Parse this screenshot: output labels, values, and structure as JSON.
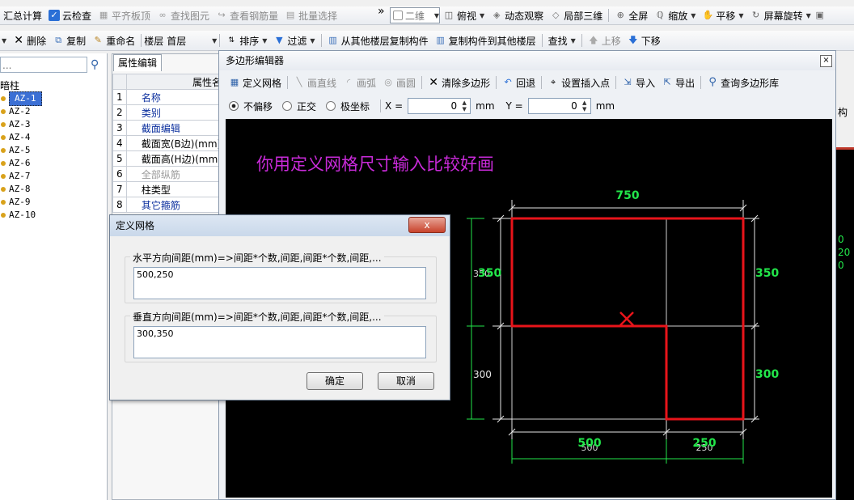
{
  "toolbar1": {
    "items": [
      {
        "label": "汇总计算",
        "icon": "sum-icon",
        "disabled": false
      },
      {
        "label": "云检查",
        "icon": "cloud-check-icon",
        "disabled": false
      },
      {
        "label": "平齐板顶",
        "icon": "align-icon",
        "disabled": true
      },
      {
        "label": "查找图元",
        "icon": "binoculars-icon",
        "disabled": true
      },
      {
        "label": "查看钢筋量",
        "icon": "rebar-icon",
        "disabled": true
      },
      {
        "label": "批量选择",
        "icon": "batch-select-icon",
        "disabled": true
      }
    ],
    "overflow": "»",
    "view_mode": "二维",
    "view_items": [
      {
        "label": "俯视",
        "has_dropdown": true
      },
      {
        "label": "动态观察",
        "has_dropdown": false
      },
      {
        "label": "局部三维",
        "has_dropdown": false
      },
      {
        "label": "全屏",
        "has_dropdown": false
      },
      {
        "label": "缩放",
        "has_dropdown": true
      },
      {
        "label": "平移",
        "has_dropdown": true
      },
      {
        "label": "屏幕旋转",
        "has_dropdown": true
      }
    ]
  },
  "toolbar2": {
    "delete": "删除",
    "copy": "复制",
    "rename": "重命名",
    "floor_label": "楼层",
    "floor_value": "首层",
    "sort": "排序",
    "filter": "过滤",
    "copy_from": "从其他楼层复制构件",
    "copy_to": "复制构件到其他楼层",
    "find": "查找",
    "up": "上移",
    "down": "下移"
  },
  "tree": {
    "search_placeholder": "...",
    "root": "暗柱",
    "items": [
      "AZ-1",
      "AZ-2",
      "AZ-3",
      "AZ-4",
      "AZ-5",
      "AZ-6",
      "AZ-7",
      "AZ-8",
      "AZ-9",
      "AZ-10"
    ],
    "selected": 0
  },
  "props": {
    "tab": "属性编辑",
    "header": "属性名",
    "rows": [
      {
        "no": "1",
        "name": "名称",
        "style": "blue"
      },
      {
        "no": "2",
        "name": "类别",
        "style": "blue"
      },
      {
        "no": "3",
        "name": "截面编辑",
        "style": "blue"
      },
      {
        "no": "4",
        "name": "截面宽(B边)(mm)",
        "style": "normal"
      },
      {
        "no": "5",
        "name": "截面高(H边)(mm)",
        "style": "normal"
      },
      {
        "no": "6",
        "name": "全部纵筋",
        "style": "grey"
      },
      {
        "no": "7",
        "name": "柱类型",
        "style": "normal"
      },
      {
        "no": "8",
        "name": "其它箍筋",
        "style": "blue"
      }
    ]
  },
  "editor": {
    "title": "多边形编辑器",
    "close": "×",
    "tools": [
      {
        "label": "定义网格",
        "icon": "grid-icon",
        "disabled": false
      },
      {
        "label": "画直线",
        "icon": "line-icon",
        "disabled": true
      },
      {
        "label": "画弧",
        "icon": "arc-icon",
        "disabled": true
      },
      {
        "label": "画圆",
        "icon": "circle-icon",
        "disabled": true
      },
      {
        "label": "清除多边形",
        "icon": "clear-icon",
        "disabled": false
      },
      {
        "label": "回退",
        "icon": "undo-icon",
        "disabled": false
      },
      {
        "label": "设置插入点",
        "icon": "insert-point-icon",
        "disabled": false
      },
      {
        "label": "导入",
        "icon": "import-icon",
        "disabled": false
      },
      {
        "label": "导出",
        "icon": "export-icon",
        "disabled": false
      },
      {
        "label": "查询多边形库",
        "icon": "magnifier-icon",
        "disabled": false
      }
    ],
    "modes": [
      "不偏移",
      "正交",
      "极坐标"
    ],
    "mode_selected": 0,
    "x_label": "X =",
    "x_value": "0",
    "y_label": "Y =",
    "y_value": "0",
    "unit": "mm",
    "annotation": "你用定义网格尺寸输入比较好画",
    "dims": {
      "top": "750",
      "left_top": "350",
      "left_top_ghost": "350",
      "left_bottom": "300",
      "right_top": "350",
      "right_bottom": "300",
      "bottom_left": "500",
      "bottom_left_ghost": "500",
      "bottom_right": "250",
      "bottom_right_ghost": "250"
    },
    "colors": {
      "outline": "#e8141a",
      "dim": "#22e64a",
      "annotation": "#c82ad8",
      "grid": "#cfcfcf"
    }
  },
  "right_edge": {
    "tab_fragment": "构",
    "lines": [
      "0",
      "20",
      "0"
    ]
  },
  "dialog": {
    "title": "定义网格",
    "close": "x",
    "h_label": "水平方向间距(mm)=>间距*个数,间距,间距*个数,间距,...",
    "h_value": "500,250",
    "v_label": "垂直方向间距(mm)=>间距*个数,间距,间距*个数,间距,...",
    "v_value": "300,350",
    "ok": "确定",
    "cancel": "取消"
  }
}
